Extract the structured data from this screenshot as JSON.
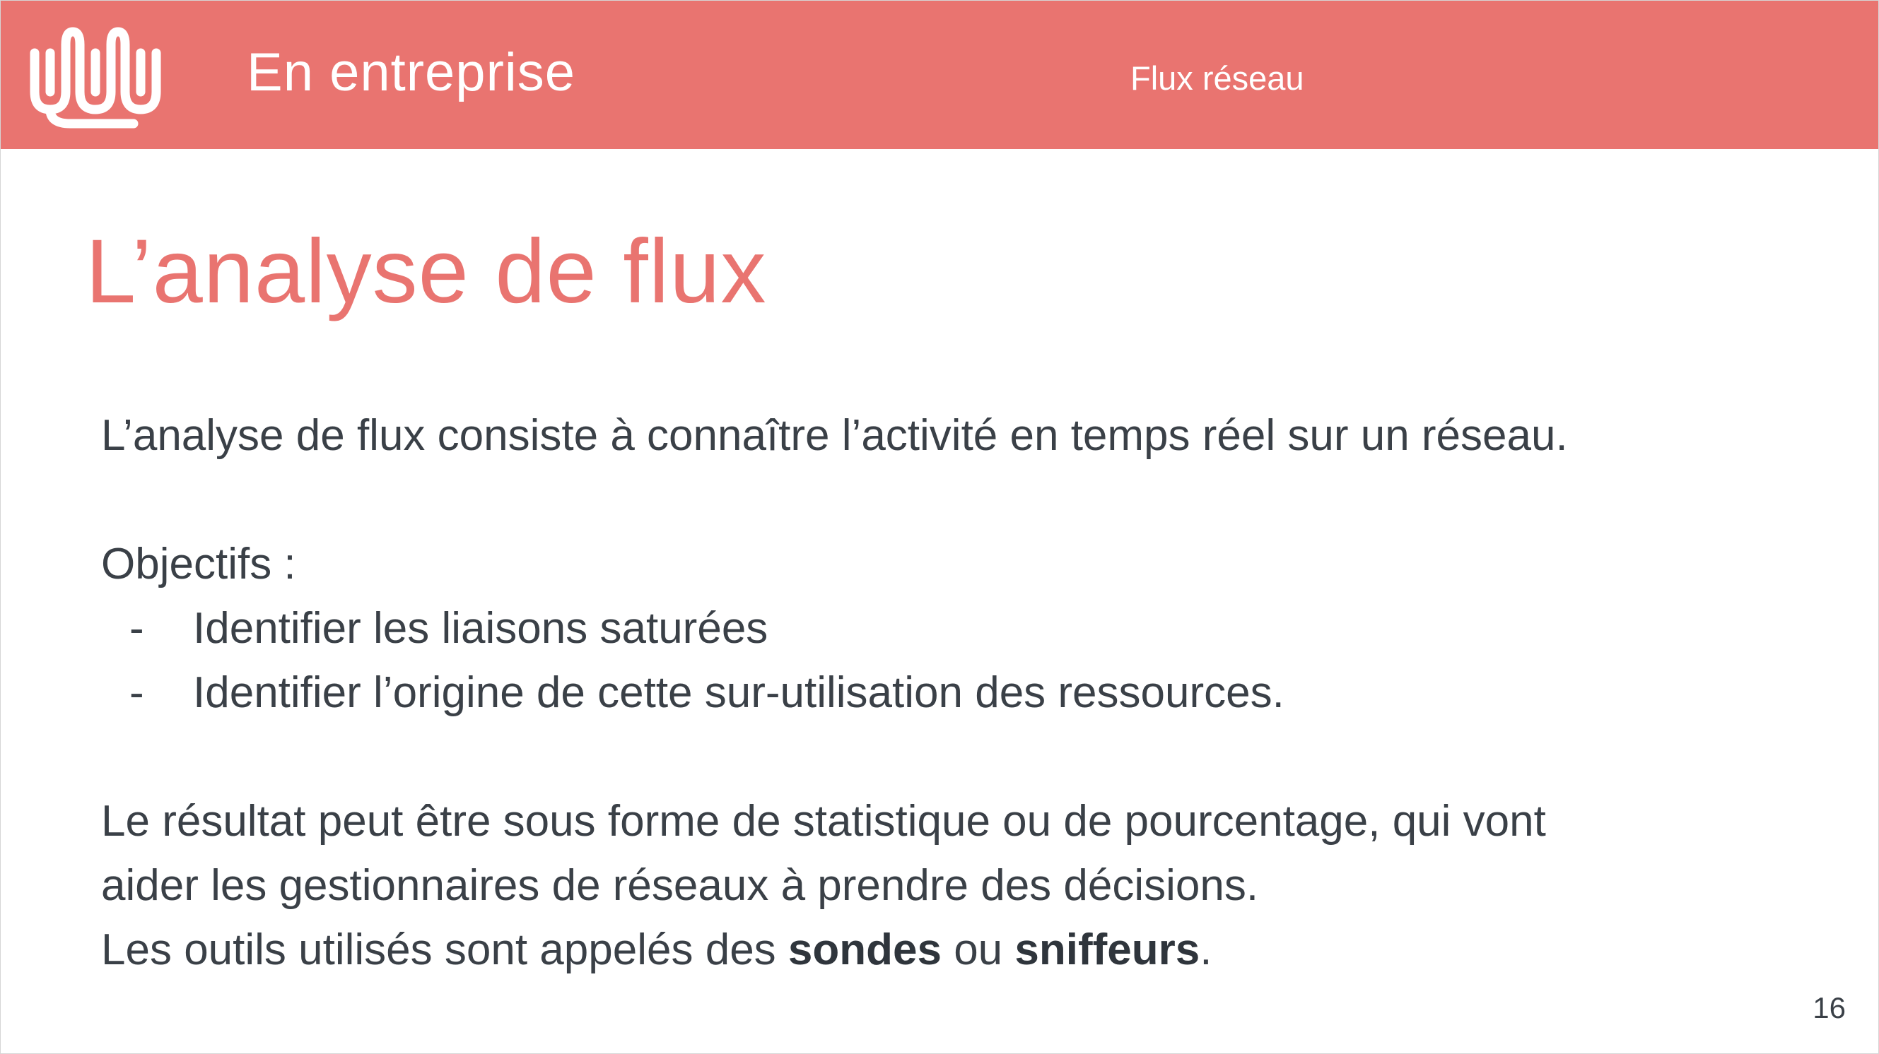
{
  "header": {
    "section_title": "En entreprise",
    "topic": "Flux réseau",
    "logo_icon": "wave-logo-icon",
    "background_color": "#e97470"
  },
  "slide": {
    "title": "L’analyse de flux",
    "intro": "L’analyse de flux consiste à connaître l’activité en temps réel sur un réseau.",
    "objectives_label": "Objectifs :",
    "objectives": [
      {
        "marker": "-",
        "text": "Identifier les liaisons saturées"
      },
      {
        "marker": "-",
        "text": "Identifier l’origine de cette sur-utilisation des ressources."
      }
    ],
    "result_line_1": "Le résultat peut être sous forme de statistique ou de pourcentage, qui vont",
    "result_line_2": "aider les gestionnaires de réseaux à prendre des décisions.",
    "tools_prefix": "Les outils utilisés sont appelés des ",
    "tools_term_1": "sondes",
    "tools_connector": " ou ",
    "tools_term_2": "sniffeurs",
    "tools_suffix": "."
  },
  "footer": {
    "page_number": "16"
  },
  "colors": {
    "accent": "#e97470",
    "text": "#3a4047"
  }
}
